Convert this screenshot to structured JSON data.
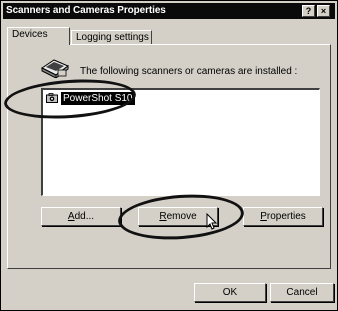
{
  "window": {
    "title": "Scanners and Cameras Properties",
    "help_button": "?",
    "close_button": "×"
  },
  "tabs": [
    {
      "label": "Devices"
    },
    {
      "label": "Logging settings"
    }
  ],
  "devices": {
    "intro_text": "The following scanners or cameras are installed :",
    "items": [
      {
        "label": "PowerShot S10"
      }
    ]
  },
  "buttons": {
    "add": {
      "mnemonic": "A",
      "rest": "dd..."
    },
    "remove": {
      "mnemonic": "R",
      "rest": "emove"
    },
    "properties": {
      "mnemonic": "P",
      "rest": "roperties"
    },
    "ok": "OK",
    "cancel": "Cancel"
  },
  "icons": {
    "scanner": "scanner-icon",
    "camera": "camera-icon",
    "cursor": "mouse-pointer-icon"
  }
}
